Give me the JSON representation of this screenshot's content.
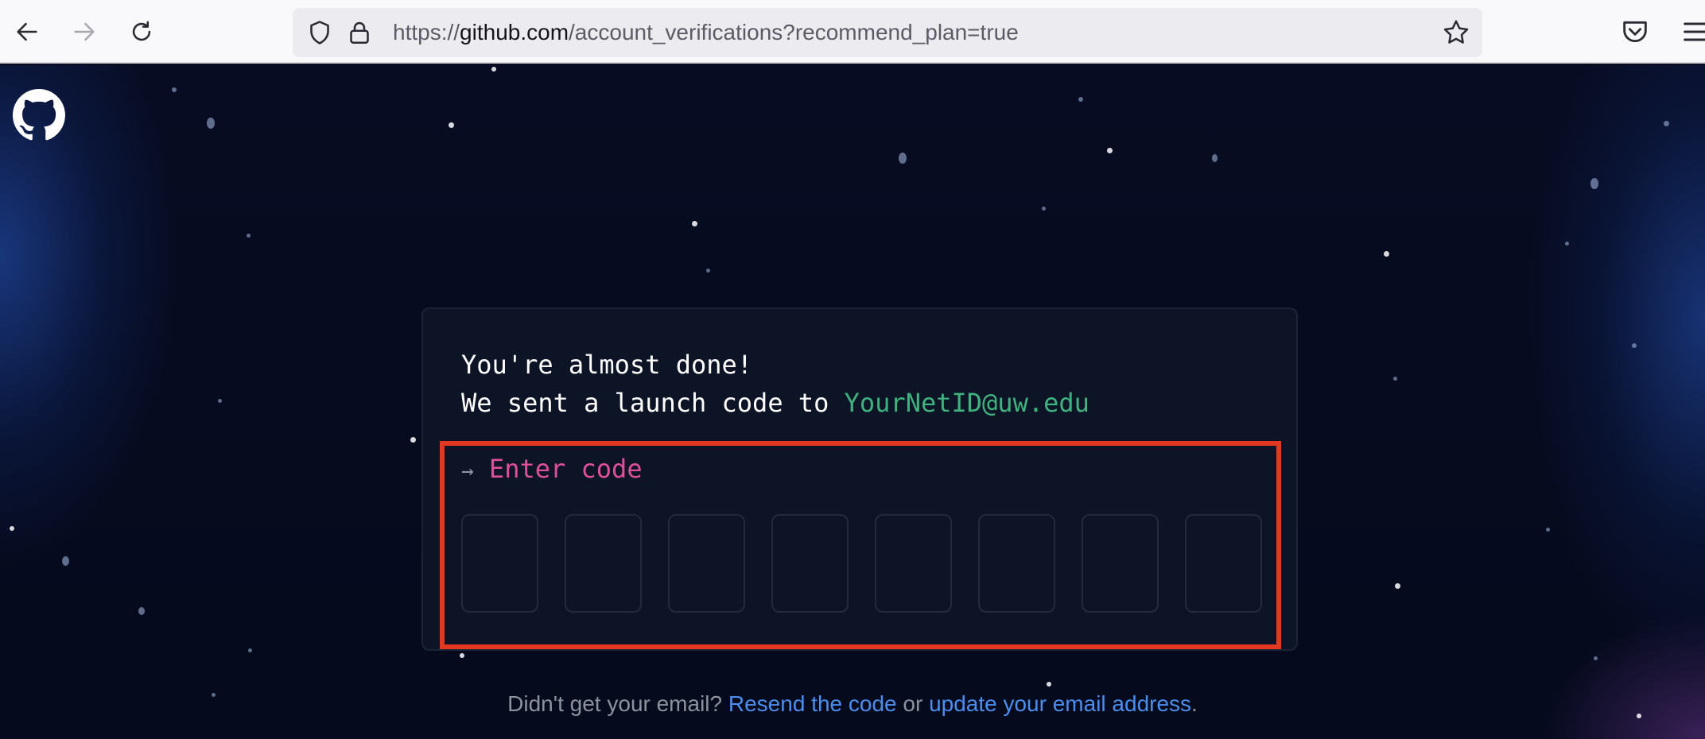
{
  "browser": {
    "url_prefix": "https://",
    "url_host": "github.com",
    "url_path": "/account_verifications?recommend_plan=true",
    "icons": [
      "back-arrow-icon",
      "forward-arrow-icon",
      "reload-icon",
      "shield-icon",
      "lock-icon",
      "bookmark-star-icon",
      "pocket-icon",
      "hamburger-menu-icon"
    ]
  },
  "page": {
    "logo": "github-octocat-icon",
    "card": {
      "line1": "You're almost done!",
      "line2_prefix": "We sent a launch code to ",
      "email": "YourNetID@uw.edu",
      "prompt_arrow": "→",
      "prompt_label": "Enter code",
      "code_cells": [
        "",
        "",
        "",
        "",
        "",
        "",
        "",
        ""
      ]
    },
    "footer": {
      "text1": "Didn't get your email? ",
      "resend_link": "Resend the code",
      "text2": " or ",
      "update_link": "update your email address",
      "text3": "."
    }
  },
  "colors": {
    "email": "#3fb27f",
    "prompt_label": "#e0509a",
    "highlight_box": "#e33822",
    "link": "#4a8ef0"
  }
}
